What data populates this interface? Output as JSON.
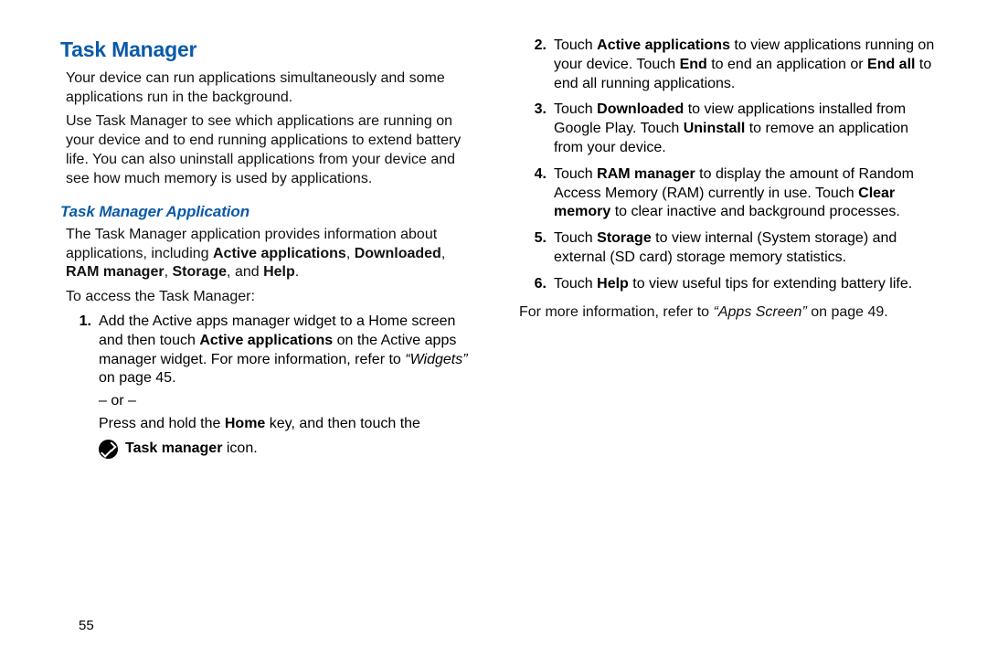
{
  "left": {
    "title": "Task Manager",
    "intro_p1": "Your device can run applications simultaneously and some applications run in the background.",
    "intro_p2": "Use Task Manager to see which applications are running on your device and to end running applications to extend battery life. You can also uninstall applications from your device and see how much memory is used by applications.",
    "sub_title": "Task Manager Application",
    "sub_intro_runs": [
      {
        "t": "The Task Manager application provides information about applications, including "
      },
      {
        "t": "Active applications",
        "b": true
      },
      {
        "t": ", "
      },
      {
        "t": "Downloaded",
        "b": true
      },
      {
        "t": ", "
      },
      {
        "t": "RAM manager",
        "b": true
      },
      {
        "t": ", "
      },
      {
        "t": "Storage",
        "b": true
      },
      {
        "t": ", and "
      },
      {
        "t": "Help",
        "b": true
      },
      {
        "t": "."
      }
    ],
    "access_line": "To access the Task Manager:",
    "step1_runs": [
      {
        "t": "Add the Active apps manager widget to a Home screen and then touch "
      },
      {
        "t": "Active applications",
        "b": true
      },
      {
        "t": " on the Active apps manager widget. For more information, refer to "
      },
      {
        "t": "“Widgets”",
        "i": true
      },
      {
        "t": " on page 45."
      }
    ],
    "or_text": "– or –",
    "press_runs": [
      {
        "t": "Press and hold the "
      },
      {
        "t": "Home",
        "b": true
      },
      {
        "t": " key, and then touch the"
      }
    ],
    "icon_label_runs": [
      {
        "t": "Task manager",
        "b": true
      },
      {
        "t": " icon."
      }
    ]
  },
  "right": {
    "steps": [
      {
        "num": "2.",
        "runs": [
          {
            "t": "Touch "
          },
          {
            "t": "Active applications",
            "b": true
          },
          {
            "t": " to view applications running on your device. Touch "
          },
          {
            "t": "End",
            "b": true
          },
          {
            "t": " to end an application or "
          },
          {
            "t": "End all",
            "b": true
          },
          {
            "t": " to end all running applications."
          }
        ]
      },
      {
        "num": "3.",
        "runs": [
          {
            "t": "Touch "
          },
          {
            "t": "Downloaded",
            "b": true
          },
          {
            "t": " to view applications installed from Google Play. Touch "
          },
          {
            "t": "Uninstall",
            "b": true
          },
          {
            "t": " to remove an application from your device."
          }
        ]
      },
      {
        "num": "4.",
        "runs": [
          {
            "t": "Touch "
          },
          {
            "t": "RAM manager",
            "b": true
          },
          {
            "t": " to display the amount of Random Access Memory (RAM) currently in use. Touch "
          },
          {
            "t": "Clear memory",
            "b": true
          },
          {
            "t": " to clear inactive and background processes."
          }
        ]
      },
      {
        "num": "5.",
        "runs": [
          {
            "t": "Touch "
          },
          {
            "t": "Storage",
            "b": true
          },
          {
            "t": " to view internal (System storage) and external (SD card) storage memory statistics."
          }
        ]
      },
      {
        "num": "6.",
        "runs": [
          {
            "t": "Touch "
          },
          {
            "t": "Help",
            "b": true
          },
          {
            "t": " to view useful tips for extending battery life."
          }
        ]
      }
    ],
    "footer_runs": [
      {
        "t": "For more information, refer to "
      },
      {
        "t": "“Apps Screen”",
        "i": true
      },
      {
        "t": " on page 49."
      }
    ]
  },
  "page_number": "55"
}
